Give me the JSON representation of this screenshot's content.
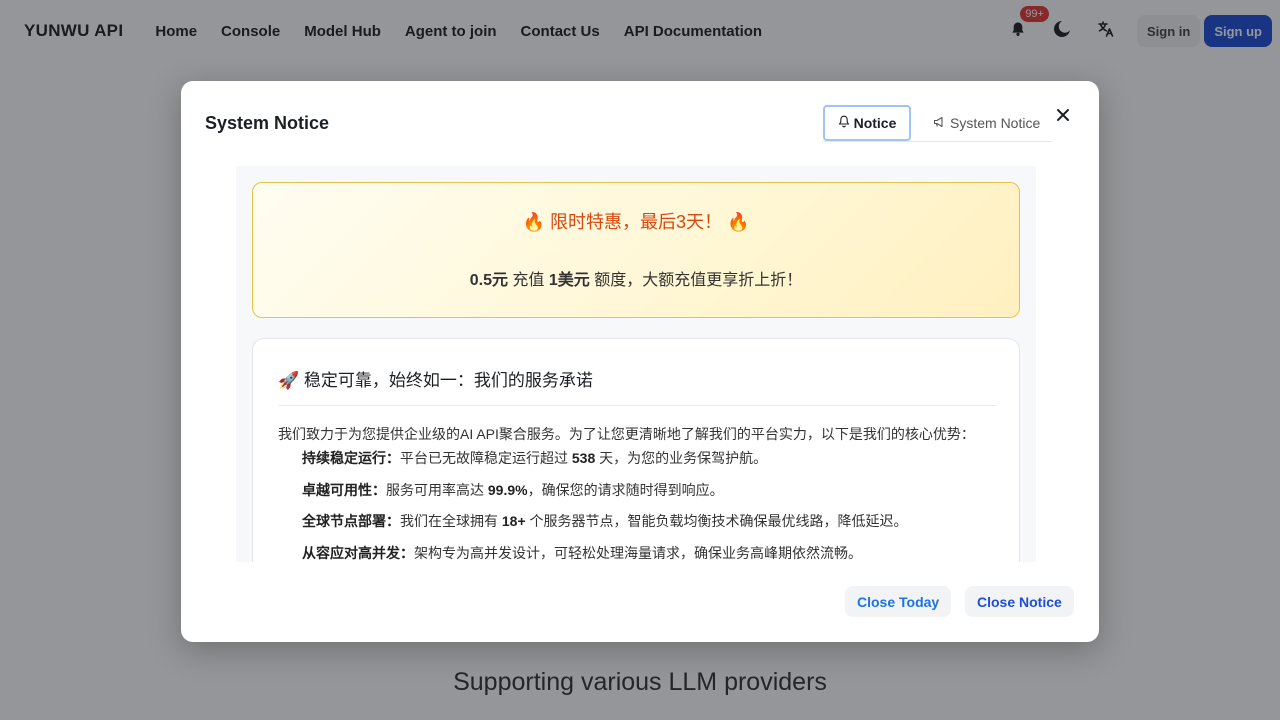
{
  "nav": {
    "brand": "YUNWU API",
    "links": [
      "Home",
      "Console",
      "Model Hub",
      "Agent to join",
      "Contact Us",
      "API Documentation"
    ],
    "badge": "99+",
    "signin": "Sign in",
    "signup": "Sign up"
  },
  "hero": {
    "subtitle": "Supporting various LLM providers"
  },
  "modal": {
    "title": "System Notice",
    "tabs": [
      "Notice",
      "System Notice"
    ],
    "promo": {
      "title": "🔥 限时特惠，最后3天！ 🔥",
      "price_bold": "0.5元",
      "charge_text": " 充值 ",
      "amount_bold": "1美元",
      "rest_text": " 额度，大额充值更享折上折！"
    },
    "card": {
      "title": "🚀 稳定可靠，始终如一：我们的服务承诺",
      "intro": "我们致力于为您提供企业级的AI API聚合服务。为了让您更清晰地了解我们的平台实力，以下是我们的核心优势：",
      "features": [
        {
          "label": "持续稳定运行：",
          "pre": "平台已无故障稳定运行超过 ",
          "value": "538",
          "post": " 天，为您的业务保驾护航。"
        },
        {
          "label": "卓越可用性：",
          "pre": "服务可用率高达 ",
          "value": "99.9%",
          "post": "，确保您的请求随时得到响应。"
        },
        {
          "label": "全球节点部署：",
          "pre": "我们在全球拥有 ",
          "value": "18+",
          "post": " 个服务器节点，智能负载均衡技术确保最优线路，降低延迟。"
        },
        {
          "label": "从容应对高并发：",
          "pre": "架构专为高并发设计，可轻松处理海量请求，确保业务高峰期依然流畅。",
          "value": "",
          "post": ""
        }
      ]
    },
    "close_today": "Close Today",
    "close_notice": "Close Notice"
  },
  "colors": {
    "accent": "#1a73e8",
    "signup_bg": "#1d4ed8",
    "promo_title": "#d9480f",
    "badge": "#e53935"
  },
  "icons": [
    "bell-icon",
    "moon-icon",
    "translate-icon",
    "notice-bell-icon",
    "megaphone-icon",
    "close-icon"
  ]
}
